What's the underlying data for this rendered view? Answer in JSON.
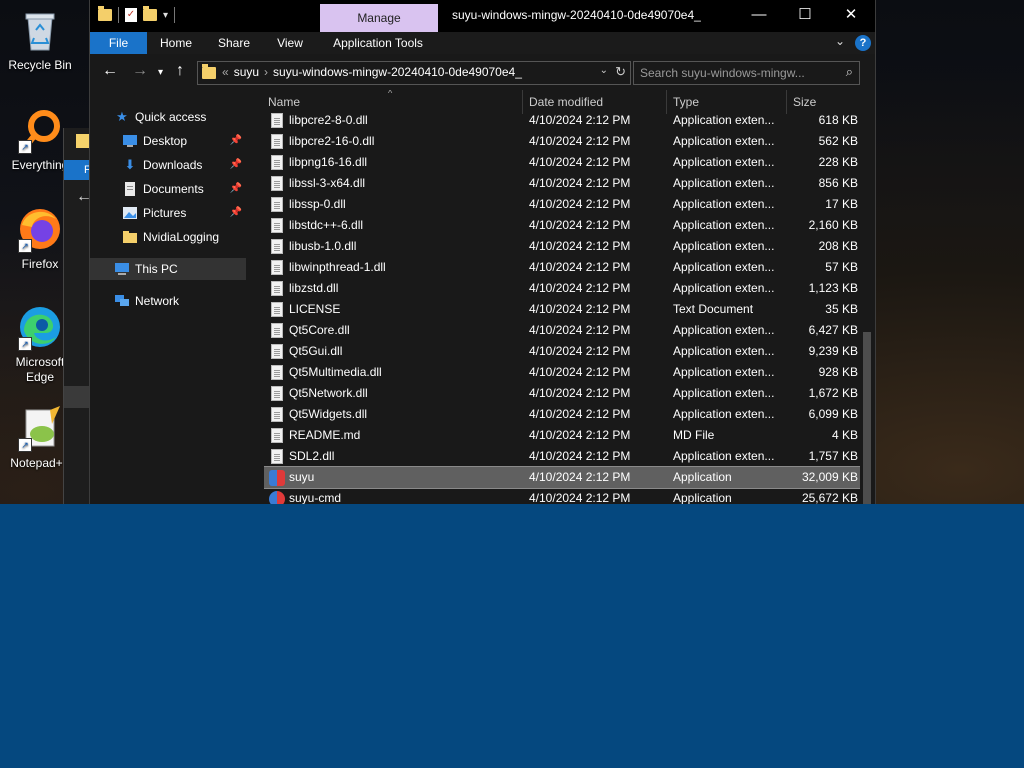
{
  "desktop": {
    "icons": [
      {
        "id": "recycle-bin",
        "label": "Recycle Bin"
      },
      {
        "id": "everything",
        "label": "Everything"
      },
      {
        "id": "firefox",
        "label": "Firefox"
      },
      {
        "id": "edge",
        "label": "Microsoft Edge"
      },
      {
        "id": "notepadpp",
        "label": "Notepad++"
      }
    ],
    "behind_window_letter": "F"
  },
  "window": {
    "title": "suyu-windows-mingw-20240410-0de49070e4_",
    "manage_tab": "Manage",
    "controls": {
      "minimize": "—",
      "maximize": "☐",
      "close": "✕"
    },
    "ribbon_tabs": [
      "File",
      "Home",
      "Share",
      "View",
      "Application Tools"
    ],
    "help": "?"
  },
  "address": {
    "overflow": "«",
    "crumbs": [
      "suyu",
      "suyu-windows-mingw-20240410-0de49070e4_"
    ],
    "search_placeholder": "Search suyu-windows-mingw..."
  },
  "nav": {
    "quick_access": "Quick access",
    "items": [
      {
        "label": "Desktop",
        "pinned": true
      },
      {
        "label": "Downloads",
        "pinned": true
      },
      {
        "label": "Documents",
        "pinned": true
      },
      {
        "label": "Pictures",
        "pinned": true
      },
      {
        "label": "NvidiaLogging",
        "pinned": false
      }
    ],
    "this_pc": "This PC",
    "network": "Network"
  },
  "columns": {
    "name": "Name",
    "date": "Date modified",
    "type": "Type",
    "size": "Size"
  },
  "files": [
    {
      "name": "libpcre2-8-0.dll",
      "date": "4/10/2024 2:12 PM",
      "type": "Application exten...",
      "size": "618 KB",
      "icon": "file"
    },
    {
      "name": "libpcre2-16-0.dll",
      "date": "4/10/2024 2:12 PM",
      "type": "Application exten...",
      "size": "562 KB",
      "icon": "file"
    },
    {
      "name": "libpng16-16.dll",
      "date": "4/10/2024 2:12 PM",
      "type": "Application exten...",
      "size": "228 KB",
      "icon": "file"
    },
    {
      "name": "libssl-3-x64.dll",
      "date": "4/10/2024 2:12 PM",
      "type": "Application exten...",
      "size": "856 KB",
      "icon": "file"
    },
    {
      "name": "libssp-0.dll",
      "date": "4/10/2024 2:12 PM",
      "type": "Application exten...",
      "size": "17 KB",
      "icon": "file"
    },
    {
      "name": "libstdc++-6.dll",
      "date": "4/10/2024 2:12 PM",
      "type": "Application exten...",
      "size": "2,160 KB",
      "icon": "file"
    },
    {
      "name": "libusb-1.0.dll",
      "date": "4/10/2024 2:12 PM",
      "type": "Application exten...",
      "size": "208 KB",
      "icon": "file"
    },
    {
      "name": "libwinpthread-1.dll",
      "date": "4/10/2024 2:12 PM",
      "type": "Application exten...",
      "size": "57 KB",
      "icon": "file"
    },
    {
      "name": "libzstd.dll",
      "date": "4/10/2024 2:12 PM",
      "type": "Application exten...",
      "size": "1,123 KB",
      "icon": "file"
    },
    {
      "name": "LICENSE",
      "date": "4/10/2024 2:12 PM",
      "type": "Text Document",
      "size": "35 KB",
      "icon": "file"
    },
    {
      "name": "Qt5Core.dll",
      "date": "4/10/2024 2:12 PM",
      "type": "Application exten...",
      "size": "6,427 KB",
      "icon": "file"
    },
    {
      "name": "Qt5Gui.dll",
      "date": "4/10/2024 2:12 PM",
      "type": "Application exten...",
      "size": "9,239 KB",
      "icon": "file"
    },
    {
      "name": "Qt5Multimedia.dll",
      "date": "4/10/2024 2:12 PM",
      "type": "Application exten...",
      "size": "928 KB",
      "icon": "file"
    },
    {
      "name": "Qt5Network.dll",
      "date": "4/10/2024 2:12 PM",
      "type": "Application exten...",
      "size": "1,672 KB",
      "icon": "file"
    },
    {
      "name": "Qt5Widgets.dll",
      "date": "4/10/2024 2:12 PM",
      "type": "Application exten...",
      "size": "6,099 KB",
      "icon": "file"
    },
    {
      "name": "README.md",
      "date": "4/10/2024 2:12 PM",
      "type": "MD File",
      "size": "4 KB",
      "icon": "file"
    },
    {
      "name": "SDL2.dll",
      "date": "4/10/2024 2:12 PM",
      "type": "Application exten...",
      "size": "1,757 KB",
      "icon": "file"
    },
    {
      "name": "suyu",
      "date": "4/10/2024 2:12 PM",
      "type": "Application",
      "size": "32,009 KB",
      "icon": "suyu",
      "selected": true
    },
    {
      "name": "suyu-cmd",
      "date": "4/10/2024 2:12 PM",
      "type": "Application",
      "size": "25,672 KB",
      "icon": "suyu-cmd"
    }
  ],
  "colors": {
    "accent": "#1a73c9",
    "manage_tab": "#d9c3f0",
    "taskbar_blue": "#05487f"
  }
}
